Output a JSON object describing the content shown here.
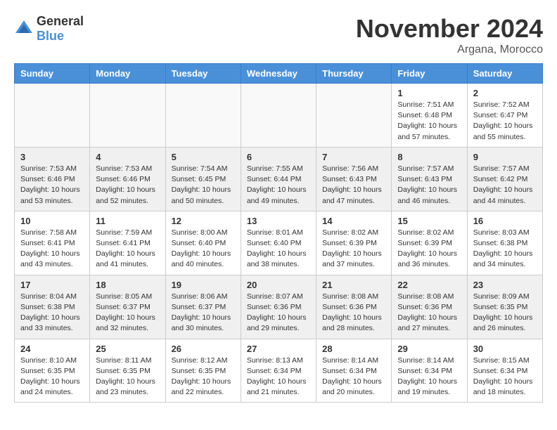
{
  "header": {
    "logo_general": "General",
    "logo_blue": "Blue",
    "month": "November 2024",
    "location": "Argana, Morocco"
  },
  "weekdays": [
    "Sunday",
    "Monday",
    "Tuesday",
    "Wednesday",
    "Thursday",
    "Friday",
    "Saturday"
  ],
  "weeks": [
    [
      {
        "day": "",
        "info": ""
      },
      {
        "day": "",
        "info": ""
      },
      {
        "day": "",
        "info": ""
      },
      {
        "day": "",
        "info": ""
      },
      {
        "day": "",
        "info": ""
      },
      {
        "day": "1",
        "info": "Sunrise: 7:51 AM\nSunset: 6:48 PM\nDaylight: 10 hours and 57 minutes."
      },
      {
        "day": "2",
        "info": "Sunrise: 7:52 AM\nSunset: 6:47 PM\nDaylight: 10 hours and 55 minutes."
      }
    ],
    [
      {
        "day": "3",
        "info": "Sunrise: 7:53 AM\nSunset: 6:46 PM\nDaylight: 10 hours and 53 minutes."
      },
      {
        "day": "4",
        "info": "Sunrise: 7:53 AM\nSunset: 6:46 PM\nDaylight: 10 hours and 52 minutes."
      },
      {
        "day": "5",
        "info": "Sunrise: 7:54 AM\nSunset: 6:45 PM\nDaylight: 10 hours and 50 minutes."
      },
      {
        "day": "6",
        "info": "Sunrise: 7:55 AM\nSunset: 6:44 PM\nDaylight: 10 hours and 49 minutes."
      },
      {
        "day": "7",
        "info": "Sunrise: 7:56 AM\nSunset: 6:43 PM\nDaylight: 10 hours and 47 minutes."
      },
      {
        "day": "8",
        "info": "Sunrise: 7:57 AM\nSunset: 6:43 PM\nDaylight: 10 hours and 46 minutes."
      },
      {
        "day": "9",
        "info": "Sunrise: 7:57 AM\nSunset: 6:42 PM\nDaylight: 10 hours and 44 minutes."
      }
    ],
    [
      {
        "day": "10",
        "info": "Sunrise: 7:58 AM\nSunset: 6:41 PM\nDaylight: 10 hours and 43 minutes."
      },
      {
        "day": "11",
        "info": "Sunrise: 7:59 AM\nSunset: 6:41 PM\nDaylight: 10 hours and 41 minutes."
      },
      {
        "day": "12",
        "info": "Sunrise: 8:00 AM\nSunset: 6:40 PM\nDaylight: 10 hours and 40 minutes."
      },
      {
        "day": "13",
        "info": "Sunrise: 8:01 AM\nSunset: 6:40 PM\nDaylight: 10 hours and 38 minutes."
      },
      {
        "day": "14",
        "info": "Sunrise: 8:02 AM\nSunset: 6:39 PM\nDaylight: 10 hours and 37 minutes."
      },
      {
        "day": "15",
        "info": "Sunrise: 8:02 AM\nSunset: 6:39 PM\nDaylight: 10 hours and 36 minutes."
      },
      {
        "day": "16",
        "info": "Sunrise: 8:03 AM\nSunset: 6:38 PM\nDaylight: 10 hours and 34 minutes."
      }
    ],
    [
      {
        "day": "17",
        "info": "Sunrise: 8:04 AM\nSunset: 6:38 PM\nDaylight: 10 hours and 33 minutes."
      },
      {
        "day": "18",
        "info": "Sunrise: 8:05 AM\nSunset: 6:37 PM\nDaylight: 10 hours and 32 minutes."
      },
      {
        "day": "19",
        "info": "Sunrise: 8:06 AM\nSunset: 6:37 PM\nDaylight: 10 hours and 30 minutes."
      },
      {
        "day": "20",
        "info": "Sunrise: 8:07 AM\nSunset: 6:36 PM\nDaylight: 10 hours and 29 minutes."
      },
      {
        "day": "21",
        "info": "Sunrise: 8:08 AM\nSunset: 6:36 PM\nDaylight: 10 hours and 28 minutes."
      },
      {
        "day": "22",
        "info": "Sunrise: 8:08 AM\nSunset: 6:36 PM\nDaylight: 10 hours and 27 minutes."
      },
      {
        "day": "23",
        "info": "Sunrise: 8:09 AM\nSunset: 6:35 PM\nDaylight: 10 hours and 26 minutes."
      }
    ],
    [
      {
        "day": "24",
        "info": "Sunrise: 8:10 AM\nSunset: 6:35 PM\nDaylight: 10 hours and 24 minutes."
      },
      {
        "day": "25",
        "info": "Sunrise: 8:11 AM\nSunset: 6:35 PM\nDaylight: 10 hours and 23 minutes."
      },
      {
        "day": "26",
        "info": "Sunrise: 8:12 AM\nSunset: 6:35 PM\nDaylight: 10 hours and 22 minutes."
      },
      {
        "day": "27",
        "info": "Sunrise: 8:13 AM\nSunset: 6:34 PM\nDaylight: 10 hours and 21 minutes."
      },
      {
        "day": "28",
        "info": "Sunrise: 8:14 AM\nSunset: 6:34 PM\nDaylight: 10 hours and 20 minutes."
      },
      {
        "day": "29",
        "info": "Sunrise: 8:14 AM\nSunset: 6:34 PM\nDaylight: 10 hours and 19 minutes."
      },
      {
        "day": "30",
        "info": "Sunrise: 8:15 AM\nSunset: 6:34 PM\nDaylight: 10 hours and 18 minutes."
      }
    ]
  ]
}
